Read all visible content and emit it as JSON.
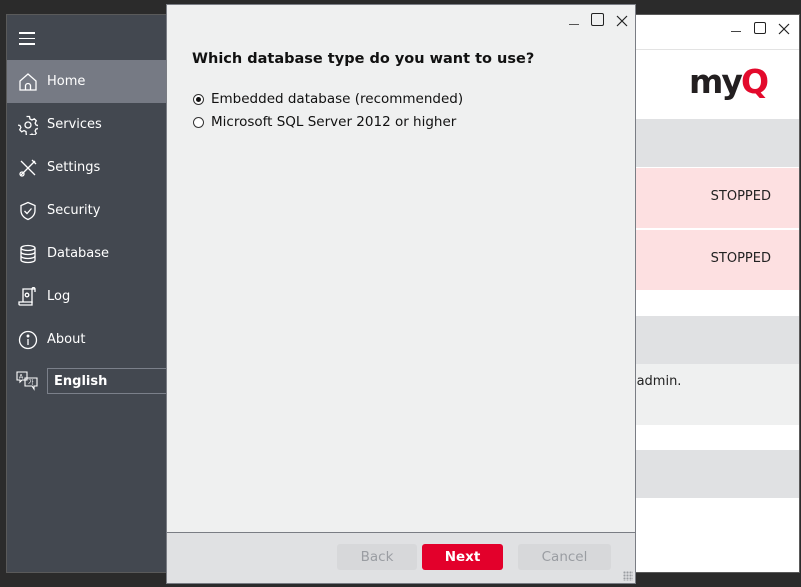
{
  "main_window": {
    "sidebar": {
      "menu_icon": "hamburger-icon",
      "items": [
        {
          "label": "Home",
          "icon": "home-icon",
          "active": true
        },
        {
          "label": "Services",
          "icon": "gear-icon",
          "active": false
        },
        {
          "label": "Settings",
          "icon": "tools-icon",
          "active": false
        },
        {
          "label": "Security",
          "icon": "shield-icon",
          "active": false
        },
        {
          "label": "Database",
          "icon": "database-icon",
          "active": false
        },
        {
          "label": "Log",
          "icon": "log-scroll-icon",
          "active": false
        },
        {
          "label": "About",
          "icon": "info-icon",
          "active": false
        }
      ],
      "language": {
        "icon": "translate-icon",
        "selected": "English"
      }
    },
    "logo": {
      "text_main": "my",
      "text_accent": "Q",
      "accent_color": "#e30a2c"
    },
    "services": [
      {
        "status": "STOPPED"
      },
      {
        "status": "STOPPED"
      }
    ],
    "partial_text": "'admin.",
    "colors": {
      "sidebar": "#434850",
      "active_item": "#767a84",
      "stopped_row": "#fde0e1"
    }
  },
  "dialog": {
    "question": "Which database type do you want to use?",
    "options": [
      {
        "label": "Embedded database (recommended)",
        "selected": true
      },
      {
        "label": "Microsoft SQL Server 2012 or higher",
        "selected": false
      }
    ],
    "buttons": {
      "back": "Back",
      "next": "Next",
      "cancel": "Cancel"
    },
    "colors": {
      "primary": "#e3002b"
    }
  }
}
